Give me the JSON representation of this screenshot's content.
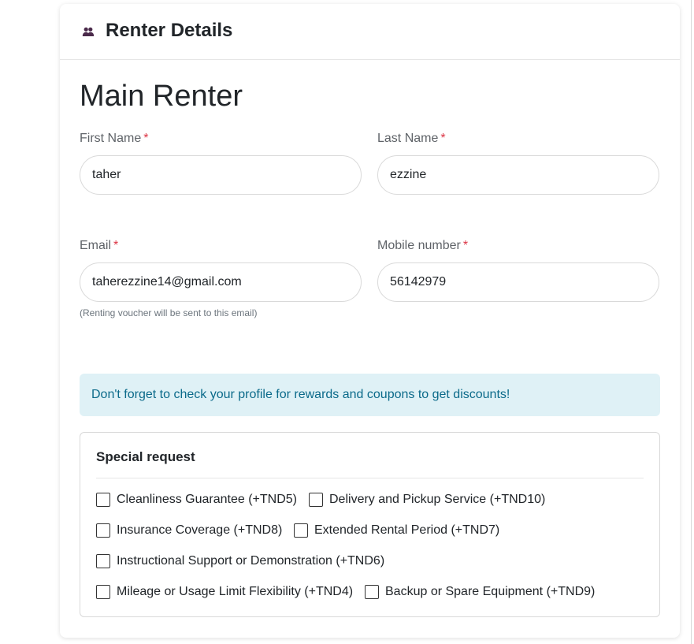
{
  "header": {
    "title": "Renter Details",
    "icon": "users-icon"
  },
  "main_renter": {
    "section_title": "Main Renter",
    "required_mark": "*",
    "first_name": {
      "label": "First Name",
      "value": "taher"
    },
    "last_name": {
      "label": "Last Name",
      "value": "ezzine"
    },
    "email": {
      "label": "Email",
      "value": "taherezzine14@gmail.com",
      "help": "(Renting voucher will be sent to this email)"
    },
    "mobile": {
      "label": "Mobile number",
      "value": "56142979"
    }
  },
  "info_alert": {
    "text": "Don't forget to check your profile for rewards and coupons to get discounts!"
  },
  "special_request": {
    "title": "Special request",
    "options": [
      {
        "label": "Cleanliness Guarantee (+TND5)",
        "checked": false
      },
      {
        "label": "Delivery and Pickup Service (+TND10)",
        "checked": false
      },
      {
        "label": "Insurance Coverage (+TND8)",
        "checked": false
      },
      {
        "label": "Extended Rental Period (+TND7)",
        "checked": false
      },
      {
        "label": "Instructional Support or Demonstration (+TND6)",
        "checked": false
      },
      {
        "label": "Mileage or Usage Limit Flexibility (+TND4)",
        "checked": false
      },
      {
        "label": "Backup or Spare Equipment (+TND9)",
        "checked": false
      }
    ]
  },
  "colors": {
    "required": "#dc3545",
    "alert_background": "#dff1f6",
    "alert_text": "#0b6a8a",
    "icon": "#4a2a4a"
  }
}
